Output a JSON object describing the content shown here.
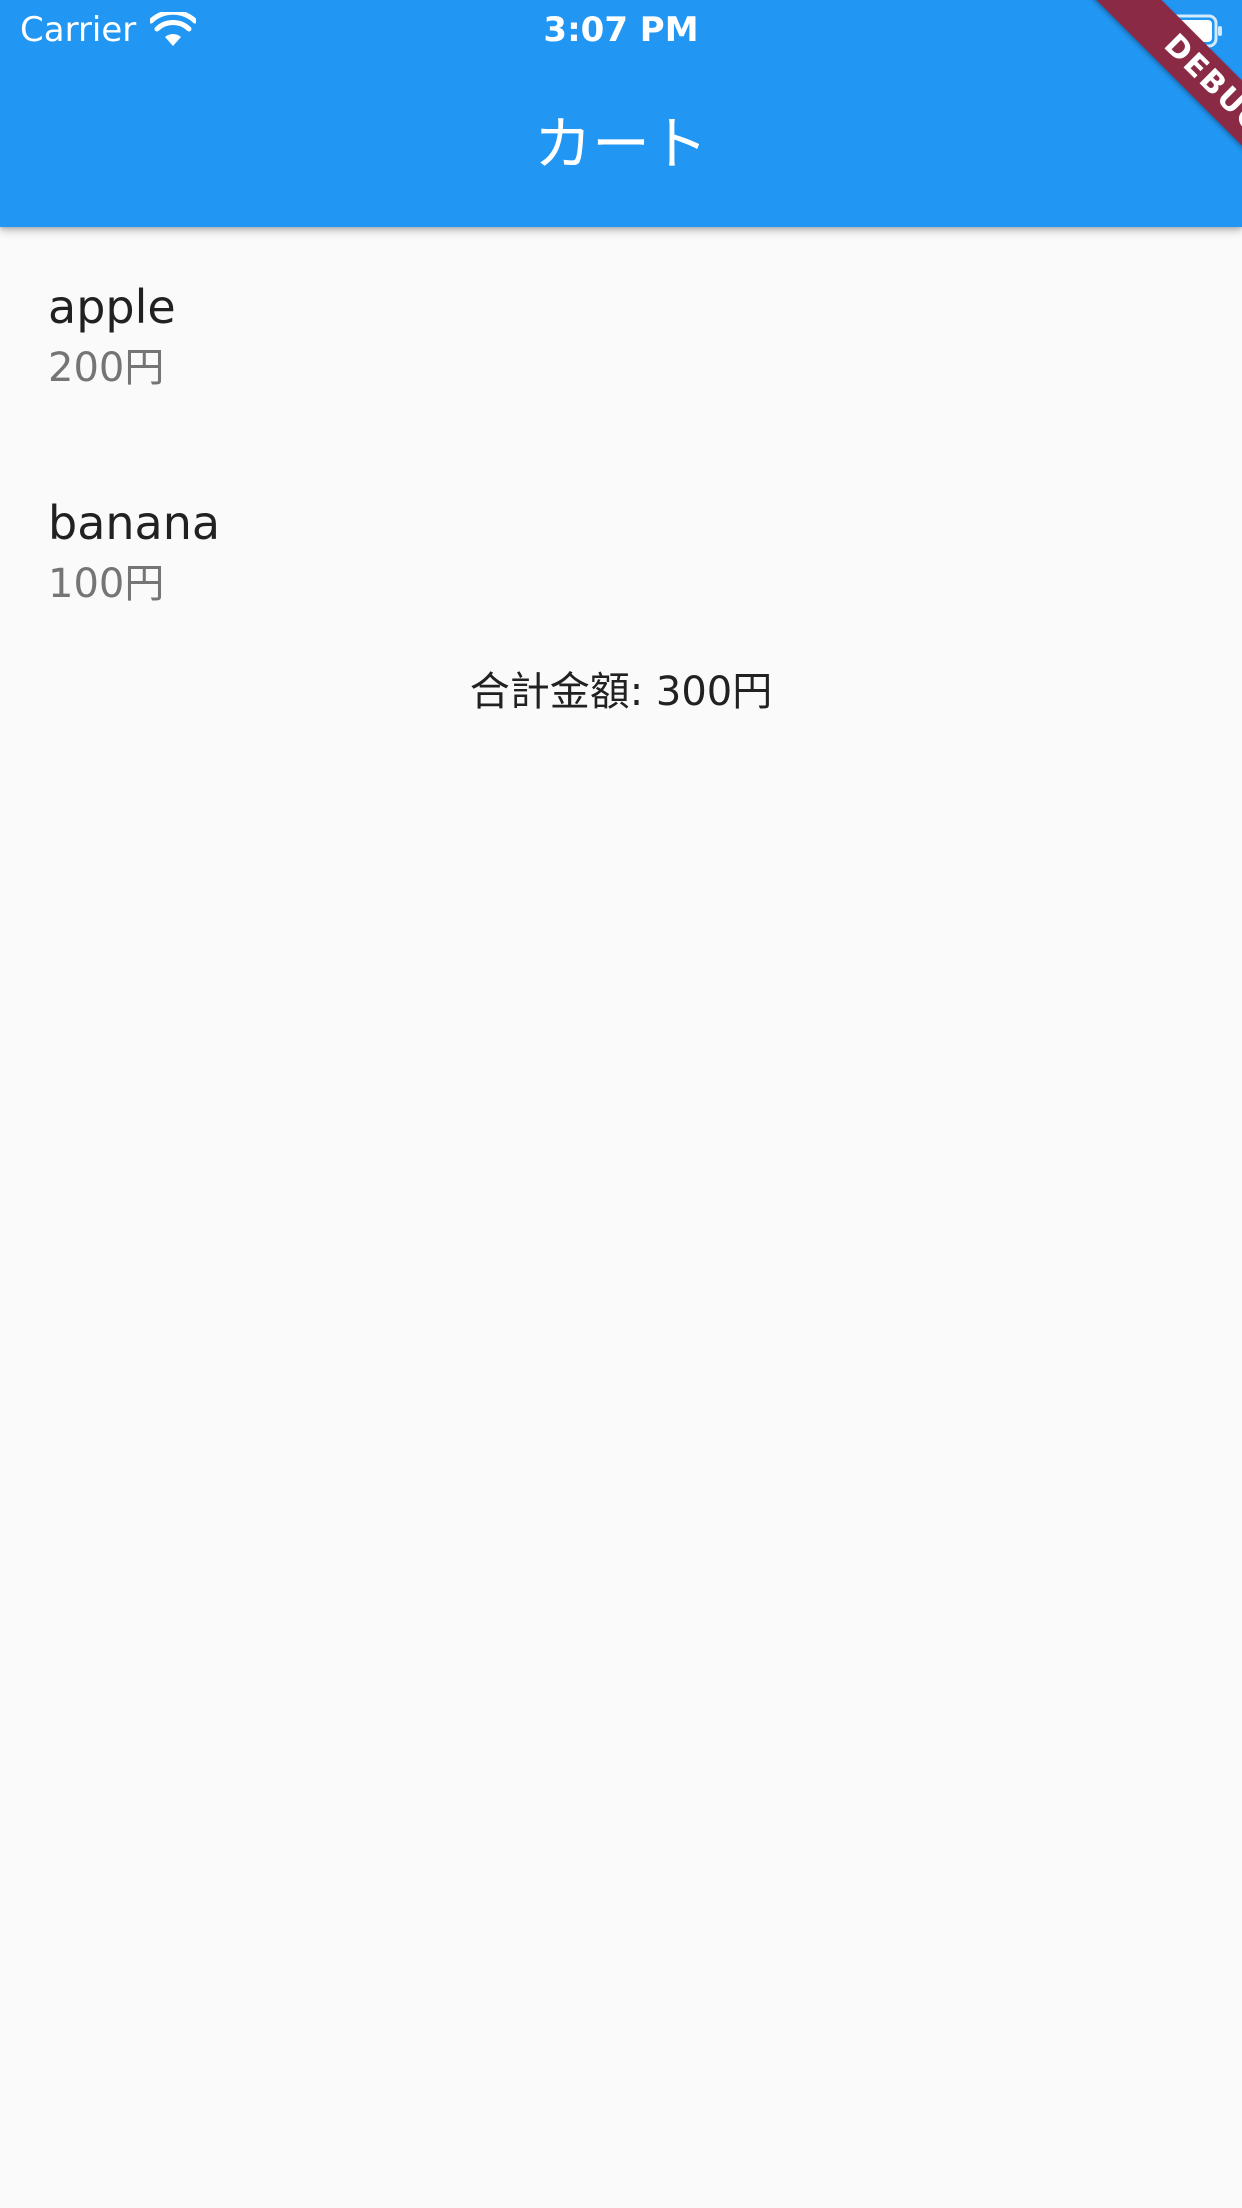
{
  "status_bar": {
    "carrier": "Carrier",
    "time": "3:07 PM",
    "wifi_icon": "wifi-icon",
    "battery_icon": "battery-icon"
  },
  "appbar": {
    "title": "カート",
    "color": "#2196f3"
  },
  "cart": {
    "items": [
      {
        "name": "apple",
        "price": "200円"
      },
      {
        "name": "banana",
        "price": "100円"
      }
    ],
    "total": "合計金額: 300円"
  },
  "debug_banner": {
    "label": "DEBUG",
    "color": "#8b2a45"
  }
}
